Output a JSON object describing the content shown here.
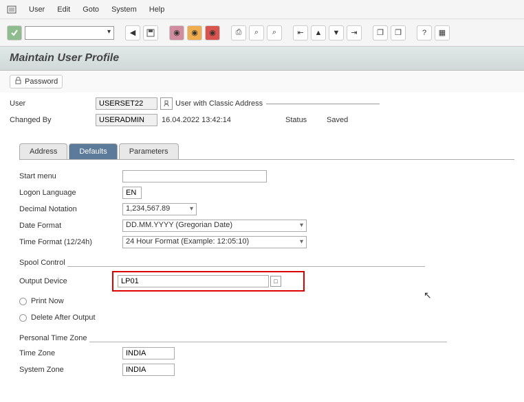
{
  "menu": {
    "user": "User",
    "edit": "Edit",
    "goto": "Goto",
    "system": "System",
    "help": "Help"
  },
  "title": "Maintain User Profile",
  "subtool": {
    "password": "Password"
  },
  "header": {
    "user_label": "User",
    "user_value": "USERSET22",
    "user_desc": "User with Classic Address",
    "changed_by_label": "Changed By",
    "changed_by_value": "USERADMIN",
    "changed_ts": "16.04.2022 13:42:14",
    "status_label": "Status",
    "status_value": "Saved"
  },
  "tabs": {
    "address": "Address",
    "defaults": "Defaults",
    "parameters": "Parameters"
  },
  "defaults": {
    "start_menu_label": "Start menu",
    "start_menu_value": "",
    "logon_lang_label": "Logon Language",
    "logon_lang_value": "EN",
    "decimal_label": "Decimal Notation",
    "decimal_value": "1,234,567.89",
    "date_label": "Date Format",
    "date_value": "DD.MM.YYYY (Gregorian Date)",
    "time_label": "Time Format (12/24h)",
    "time_value": "24 Hour Format (Example: 12:05:10)"
  },
  "spool": {
    "group_label": "Spool Control",
    "output_device_label": "Output Device",
    "output_device_value": "LP01",
    "print_now_label": "Print Now",
    "delete_after_label": "Delete After Output"
  },
  "tz": {
    "group_label": "Personal Time Zone",
    "timezone_label": "Time Zone",
    "timezone_value": "INDIA",
    "system_zone_label": "System Zone",
    "system_zone_value": "INDIA"
  }
}
